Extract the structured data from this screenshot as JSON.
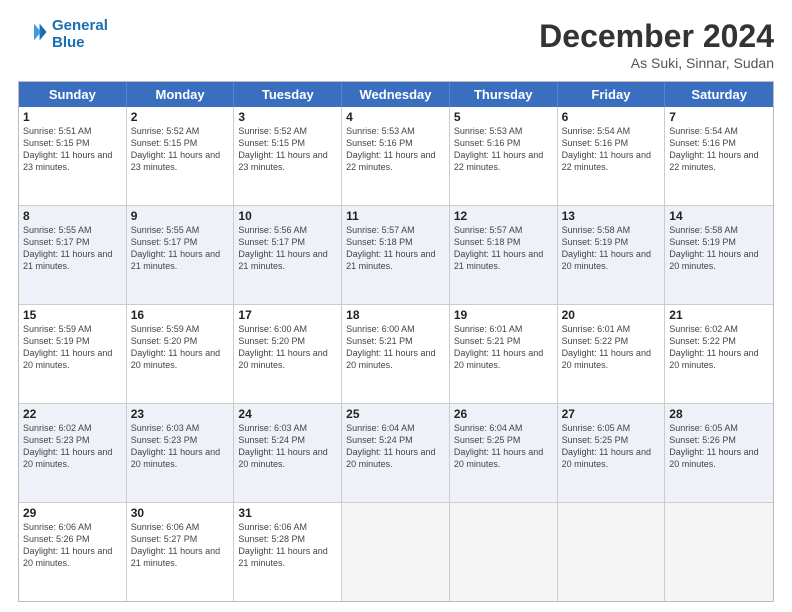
{
  "header": {
    "logo_line1": "General",
    "logo_line2": "Blue",
    "month": "December 2024",
    "location": "As Suki, Sinnar, Sudan"
  },
  "days_of_week": [
    "Sunday",
    "Monday",
    "Tuesday",
    "Wednesday",
    "Thursday",
    "Friday",
    "Saturday"
  ],
  "weeks": [
    [
      {
        "day": "1",
        "sunrise": "Sunrise: 5:51 AM",
        "sunset": "Sunset: 5:15 PM",
        "daylight": "Daylight: 11 hours and 23 minutes."
      },
      {
        "day": "2",
        "sunrise": "Sunrise: 5:52 AM",
        "sunset": "Sunset: 5:15 PM",
        "daylight": "Daylight: 11 hours and 23 minutes."
      },
      {
        "day": "3",
        "sunrise": "Sunrise: 5:52 AM",
        "sunset": "Sunset: 5:15 PM",
        "daylight": "Daylight: 11 hours and 23 minutes."
      },
      {
        "day": "4",
        "sunrise": "Sunrise: 5:53 AM",
        "sunset": "Sunset: 5:16 PM",
        "daylight": "Daylight: 11 hours and 22 minutes."
      },
      {
        "day": "5",
        "sunrise": "Sunrise: 5:53 AM",
        "sunset": "Sunset: 5:16 PM",
        "daylight": "Daylight: 11 hours and 22 minutes."
      },
      {
        "day": "6",
        "sunrise": "Sunrise: 5:54 AM",
        "sunset": "Sunset: 5:16 PM",
        "daylight": "Daylight: 11 hours and 22 minutes."
      },
      {
        "day": "7",
        "sunrise": "Sunrise: 5:54 AM",
        "sunset": "Sunset: 5:16 PM",
        "daylight": "Daylight: 11 hours and 22 minutes."
      }
    ],
    [
      {
        "day": "8",
        "sunrise": "Sunrise: 5:55 AM",
        "sunset": "Sunset: 5:17 PM",
        "daylight": "Daylight: 11 hours and 21 minutes."
      },
      {
        "day": "9",
        "sunrise": "Sunrise: 5:55 AM",
        "sunset": "Sunset: 5:17 PM",
        "daylight": "Daylight: 11 hours and 21 minutes."
      },
      {
        "day": "10",
        "sunrise": "Sunrise: 5:56 AM",
        "sunset": "Sunset: 5:17 PM",
        "daylight": "Daylight: 11 hours and 21 minutes."
      },
      {
        "day": "11",
        "sunrise": "Sunrise: 5:57 AM",
        "sunset": "Sunset: 5:18 PM",
        "daylight": "Daylight: 11 hours and 21 minutes."
      },
      {
        "day": "12",
        "sunrise": "Sunrise: 5:57 AM",
        "sunset": "Sunset: 5:18 PM",
        "daylight": "Daylight: 11 hours and 21 minutes."
      },
      {
        "day": "13",
        "sunrise": "Sunrise: 5:58 AM",
        "sunset": "Sunset: 5:19 PM",
        "daylight": "Daylight: 11 hours and 20 minutes."
      },
      {
        "day": "14",
        "sunrise": "Sunrise: 5:58 AM",
        "sunset": "Sunset: 5:19 PM",
        "daylight": "Daylight: 11 hours and 20 minutes."
      }
    ],
    [
      {
        "day": "15",
        "sunrise": "Sunrise: 5:59 AM",
        "sunset": "Sunset: 5:19 PM",
        "daylight": "Daylight: 11 hours and 20 minutes."
      },
      {
        "day": "16",
        "sunrise": "Sunrise: 5:59 AM",
        "sunset": "Sunset: 5:20 PM",
        "daylight": "Daylight: 11 hours and 20 minutes."
      },
      {
        "day": "17",
        "sunrise": "Sunrise: 6:00 AM",
        "sunset": "Sunset: 5:20 PM",
        "daylight": "Daylight: 11 hours and 20 minutes."
      },
      {
        "day": "18",
        "sunrise": "Sunrise: 6:00 AM",
        "sunset": "Sunset: 5:21 PM",
        "daylight": "Daylight: 11 hours and 20 minutes."
      },
      {
        "day": "19",
        "sunrise": "Sunrise: 6:01 AM",
        "sunset": "Sunset: 5:21 PM",
        "daylight": "Daylight: 11 hours and 20 minutes."
      },
      {
        "day": "20",
        "sunrise": "Sunrise: 6:01 AM",
        "sunset": "Sunset: 5:22 PM",
        "daylight": "Daylight: 11 hours and 20 minutes."
      },
      {
        "day": "21",
        "sunrise": "Sunrise: 6:02 AM",
        "sunset": "Sunset: 5:22 PM",
        "daylight": "Daylight: 11 hours and 20 minutes."
      }
    ],
    [
      {
        "day": "22",
        "sunrise": "Sunrise: 6:02 AM",
        "sunset": "Sunset: 5:23 PM",
        "daylight": "Daylight: 11 hours and 20 minutes."
      },
      {
        "day": "23",
        "sunrise": "Sunrise: 6:03 AM",
        "sunset": "Sunset: 5:23 PM",
        "daylight": "Daylight: 11 hours and 20 minutes."
      },
      {
        "day": "24",
        "sunrise": "Sunrise: 6:03 AM",
        "sunset": "Sunset: 5:24 PM",
        "daylight": "Daylight: 11 hours and 20 minutes."
      },
      {
        "day": "25",
        "sunrise": "Sunrise: 6:04 AM",
        "sunset": "Sunset: 5:24 PM",
        "daylight": "Daylight: 11 hours and 20 minutes."
      },
      {
        "day": "26",
        "sunrise": "Sunrise: 6:04 AM",
        "sunset": "Sunset: 5:25 PM",
        "daylight": "Daylight: 11 hours and 20 minutes."
      },
      {
        "day": "27",
        "sunrise": "Sunrise: 6:05 AM",
        "sunset": "Sunset: 5:25 PM",
        "daylight": "Daylight: 11 hours and 20 minutes."
      },
      {
        "day": "28",
        "sunrise": "Sunrise: 6:05 AM",
        "sunset": "Sunset: 5:26 PM",
        "daylight": "Daylight: 11 hours and 20 minutes."
      }
    ],
    [
      {
        "day": "29",
        "sunrise": "Sunrise: 6:06 AM",
        "sunset": "Sunset: 5:26 PM",
        "daylight": "Daylight: 11 hours and 20 minutes."
      },
      {
        "day": "30",
        "sunrise": "Sunrise: 6:06 AM",
        "sunset": "Sunset: 5:27 PM",
        "daylight": "Daylight: 11 hours and 21 minutes."
      },
      {
        "day": "31",
        "sunrise": "Sunrise: 6:06 AM",
        "sunset": "Sunset: 5:28 PM",
        "daylight": "Daylight: 11 hours and 21 minutes."
      },
      null,
      null,
      null,
      null
    ]
  ]
}
